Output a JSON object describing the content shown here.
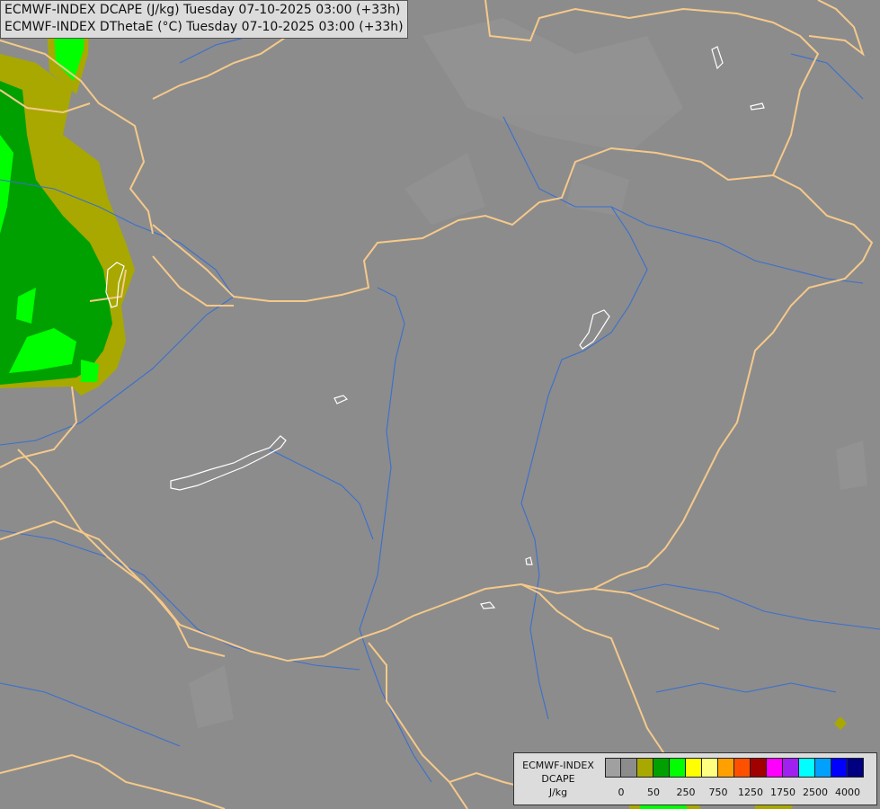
{
  "header": {
    "line1": "ECMWF-INDEX DCAPE (J/kg) Tuesday 07-10-2025 03:00 (+33h)",
    "line2": "ECMWF-INDEX DThetaE (°C) Tuesday 07-10-2025 03:00 (+33h)"
  },
  "legend": {
    "line1": "ECMWF-INDEX",
    "line2": "DCAPE",
    "line3": "J/kg",
    "colors": [
      "#a0a0a0",
      "#8c8c8c",
      "#a8a800",
      "#00a000",
      "#00ff00",
      "#ffff00",
      "#ffff80",
      "#ffa000",
      "#ff5000",
      "#a00000",
      "#ff00ff",
      "#a020f0",
      "#00ffff",
      "#00a0ff",
      "#0000ff",
      "#000080"
    ],
    "ticks": [
      {
        "label": "0",
        "index": 1
      },
      {
        "label": "50",
        "index": 3
      },
      {
        "label": "250",
        "index": 5
      },
      {
        "label": "750",
        "index": 7
      },
      {
        "label": "1250",
        "index": 9
      },
      {
        "label": "1750",
        "index": 11
      },
      {
        "label": "2500",
        "index": 13
      },
      {
        "label": "4000",
        "index": 15
      }
    ]
  },
  "map_colors": {
    "background": "#8c8c8c",
    "dcape_50": "#a8a800",
    "dcape_250": "#00a000",
    "dcape_500": "#00ff00",
    "borders": "#f5c98a",
    "rivers": "#3a6fd0",
    "lakes": "#ffffff"
  }
}
